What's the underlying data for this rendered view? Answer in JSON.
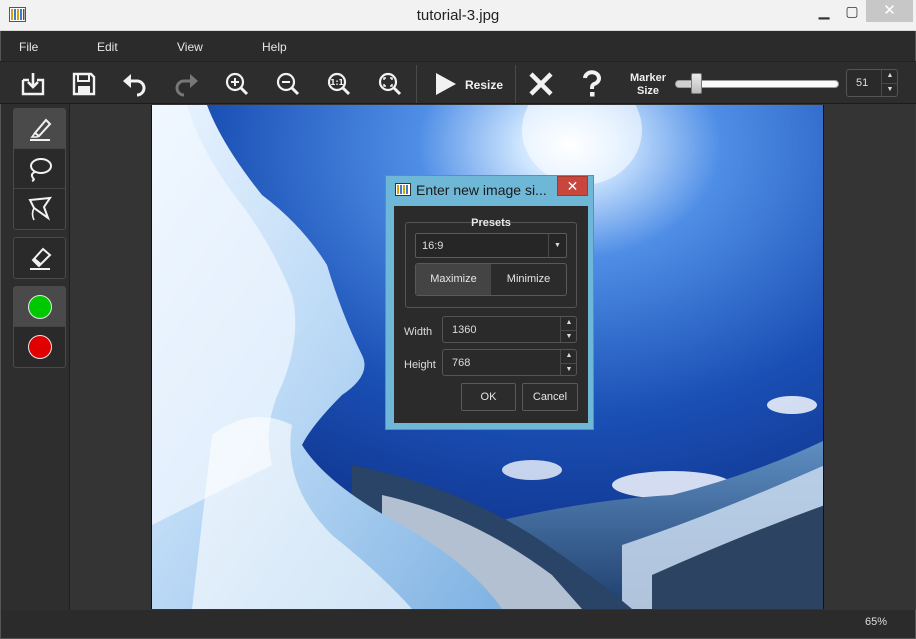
{
  "window": {
    "title": "tutorial-3.jpg",
    "minimize": "▁",
    "maximize": "▢",
    "close": "✕"
  },
  "menu": [
    "File",
    "Edit",
    "View",
    "Help"
  ],
  "toolbar": {
    "buttons": [
      "open-icon",
      "save-icon",
      "undo-icon",
      "redo-icon",
      "zoom-in-icon",
      "zoom-out-icon",
      "zoom-actual-icon",
      "zoom-fit-icon",
      "resize-play-icon",
      "clear-icon",
      "help-icon"
    ],
    "resize_label": "Resize",
    "marker_label_1": "Marker",
    "marker_label_2": "Size",
    "marker_value": "51",
    "marker_fraction": 0.1
  },
  "tools": {
    "group1": [
      "marker-icon",
      "lasso-icon",
      "polygon-lasso-icon"
    ],
    "eraser": "eraser-icon",
    "colors": {
      "keep": "#00c800",
      "remove": "#e00000"
    }
  },
  "dialog": {
    "title": "Enter new image si...",
    "close": "✕",
    "presets_title": "Presets",
    "preset_selected": "16:9",
    "maximize": "Maximize",
    "minimize": "Minimize",
    "width_label": "Width",
    "width_value": "1360",
    "height_label": "Height",
    "height_value": "768",
    "ok": "OK",
    "cancel": "Cancel"
  },
  "status": {
    "zoom": "65%"
  }
}
